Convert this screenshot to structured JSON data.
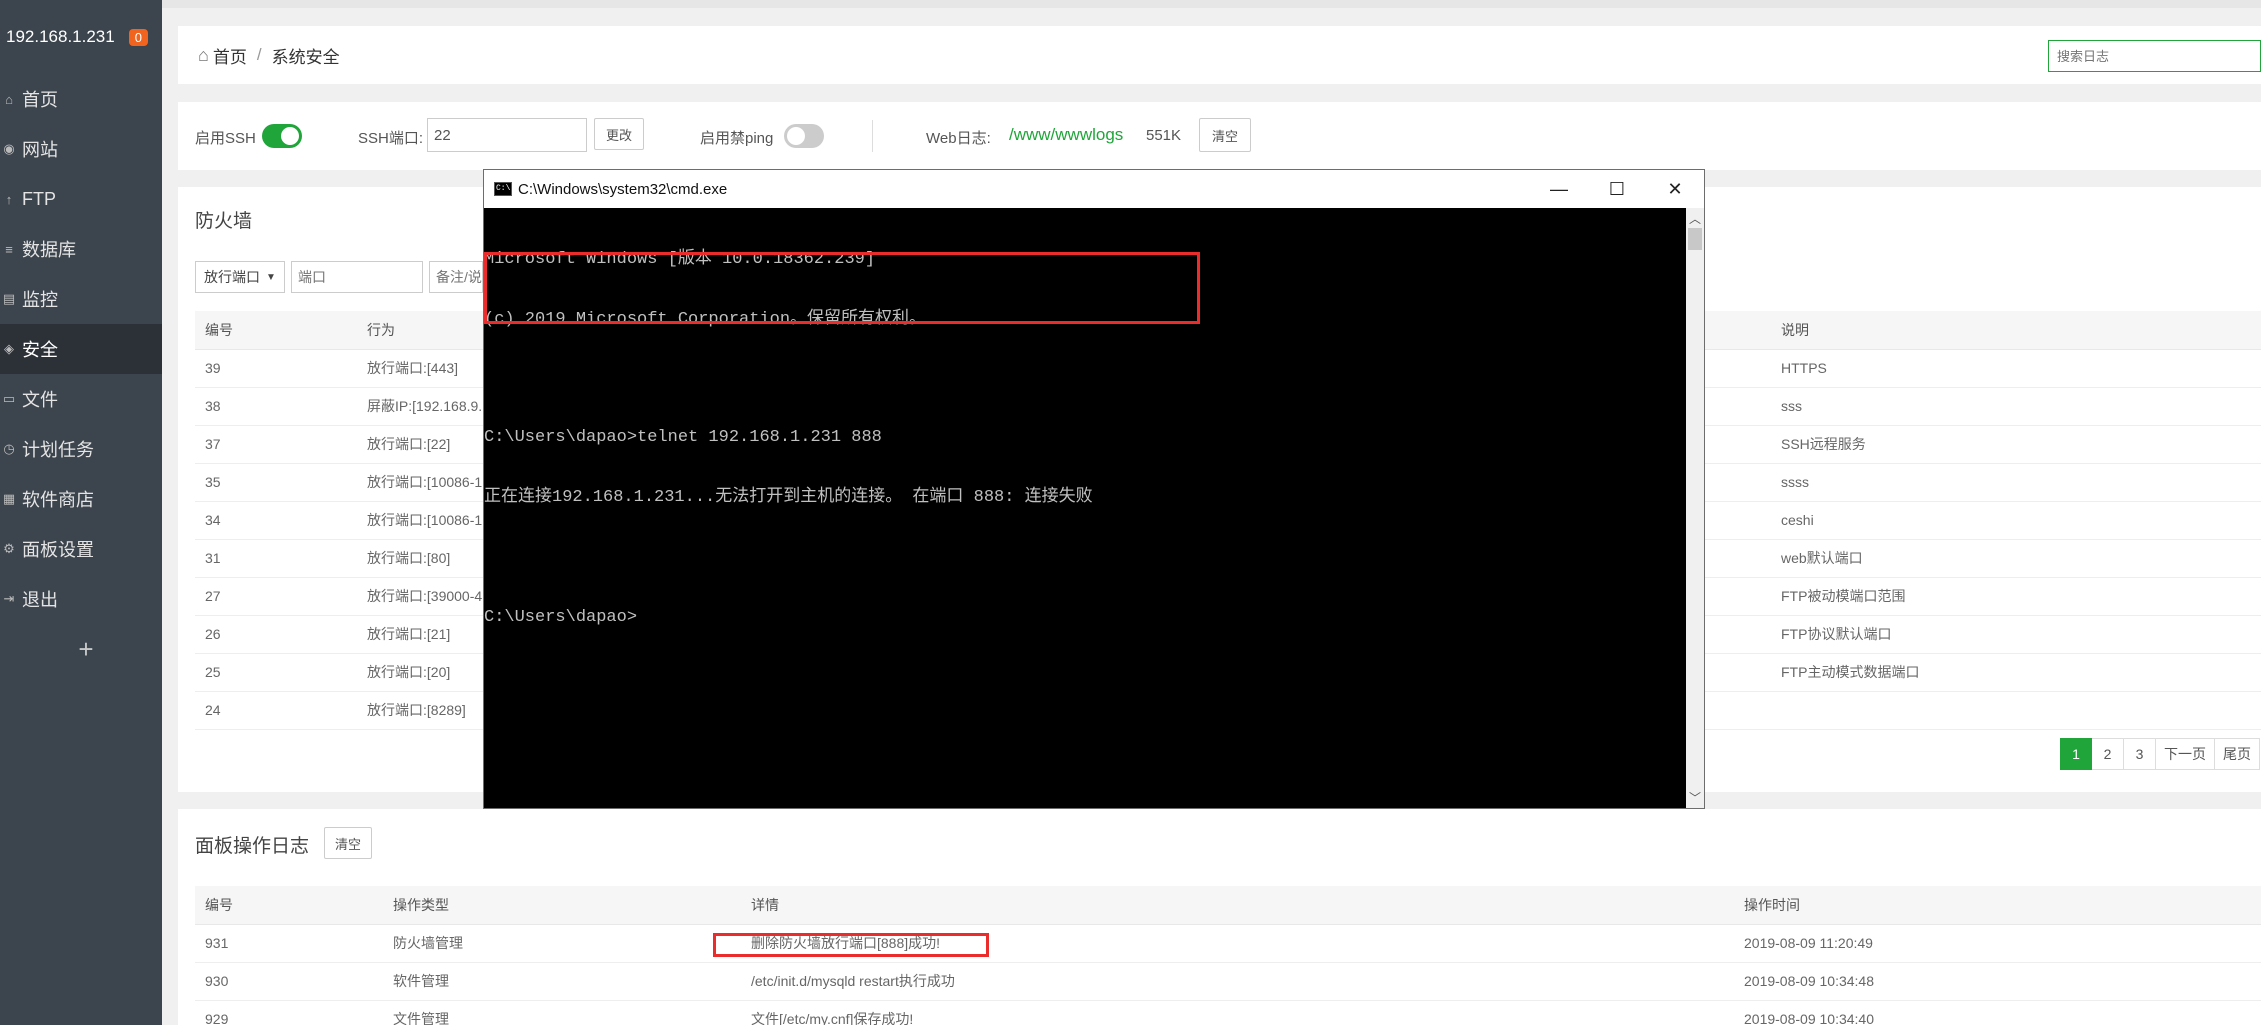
{
  "sidebar": {
    "host": "192.168.1.231",
    "badge": "0",
    "items": [
      {
        "label": "首页"
      },
      {
        "label": "网站"
      },
      {
        "label": "FTP"
      },
      {
        "label": "数据库"
      },
      {
        "label": "监控"
      },
      {
        "label": "安全"
      },
      {
        "label": "文件"
      },
      {
        "label": "计划任务"
      },
      {
        "label": "软件商店"
      },
      {
        "label": "面板设置"
      },
      {
        "label": "退出"
      }
    ],
    "add": "+"
  },
  "breadcrumb": {
    "home": "首页",
    "sep": "/",
    "current": "系统安全"
  },
  "log_search": {
    "placeholder": "搜索日志"
  },
  "ssh": {
    "enable_label": "启用SSH",
    "port_label": "SSH端口:",
    "port_value": "22",
    "change_btn": "更改",
    "ping_label": "启用禁ping",
    "weblog_label": "Web日志:",
    "weblog_path": "/www/wwwlogs",
    "weblog_size": "551K",
    "clear_btn": "清空",
    "ssh_enabled": true,
    "ping_enabled": false
  },
  "firewall": {
    "title": "防火墙",
    "select_value": "放行端口",
    "port_placeholder": "端口",
    "remark_placeholder": "备注/说",
    "columns": [
      "编号",
      "行为",
      "说明"
    ],
    "rows": [
      {
        "id": "39",
        "action": "放行端口:[443]",
        "note": "HTTPS"
      },
      {
        "id": "38",
        "action": "屏蔽IP:[192.168.9.1",
        "note": "sss"
      },
      {
        "id": "37",
        "action": "放行端口:[22]",
        "note": "SSH远程服务"
      },
      {
        "id": "35",
        "action": "放行端口:[10086-1",
        "note": "ssss"
      },
      {
        "id": "34",
        "action": "放行端口:[10086-1",
        "note": "ceshi"
      },
      {
        "id": "31",
        "action": "放行端口:[80]",
        "note": "web默认端口"
      },
      {
        "id": "27",
        "action": "放行端口:[39000-4",
        "note": "FTP被动模端口范围"
      },
      {
        "id": "26",
        "action": "放行端口:[21]",
        "note": "FTP协议默认端口"
      },
      {
        "id": "25",
        "action": "放行端口:[20]",
        "note": "FTP主动模式数据端口"
      },
      {
        "id": "24",
        "action": "放行端口:[8289]",
        "note": ""
      }
    ],
    "pager": [
      "1",
      "2",
      "3",
      "下一页",
      "尾页"
    ]
  },
  "panel_log": {
    "title": "面板操作日志",
    "clear_btn": "清空",
    "columns": [
      "编号",
      "操作类型",
      "详情",
      "操作时间"
    ],
    "rows": [
      {
        "id": "931",
        "type": "防火墙管理",
        "detail": "删除防火墙放行端口[888]成功!",
        "time": "2019-08-09 11:20:49"
      },
      {
        "id": "930",
        "type": "软件管理",
        "detail": "/etc/init.d/mysqld restart执行成功",
        "time": "2019-08-09 10:34:48"
      },
      {
        "id": "929",
        "type": "文件管理",
        "detail": "文件[/etc/my.cnf]保存成功!",
        "time": "2019-08-09 10:34:40"
      }
    ]
  },
  "cmd": {
    "title": "C:\\Windows\\system32\\cmd.exe",
    "icon_text": "C:\\",
    "min": "—",
    "max": "☐",
    "close": "✕",
    "lines": [
      "Microsoft Windows [版本 10.0.18362.239]",
      "(c) 2019 Microsoft Corporation。保留所有权利。",
      "",
      "C:\\Users\\dapao>telnet 192.168.1.231 888",
      "正在连接192.168.1.231...无法打开到主机的连接。 在端口 888: 连接失败",
      "",
      "C:\\Users\\dapao>"
    ]
  }
}
